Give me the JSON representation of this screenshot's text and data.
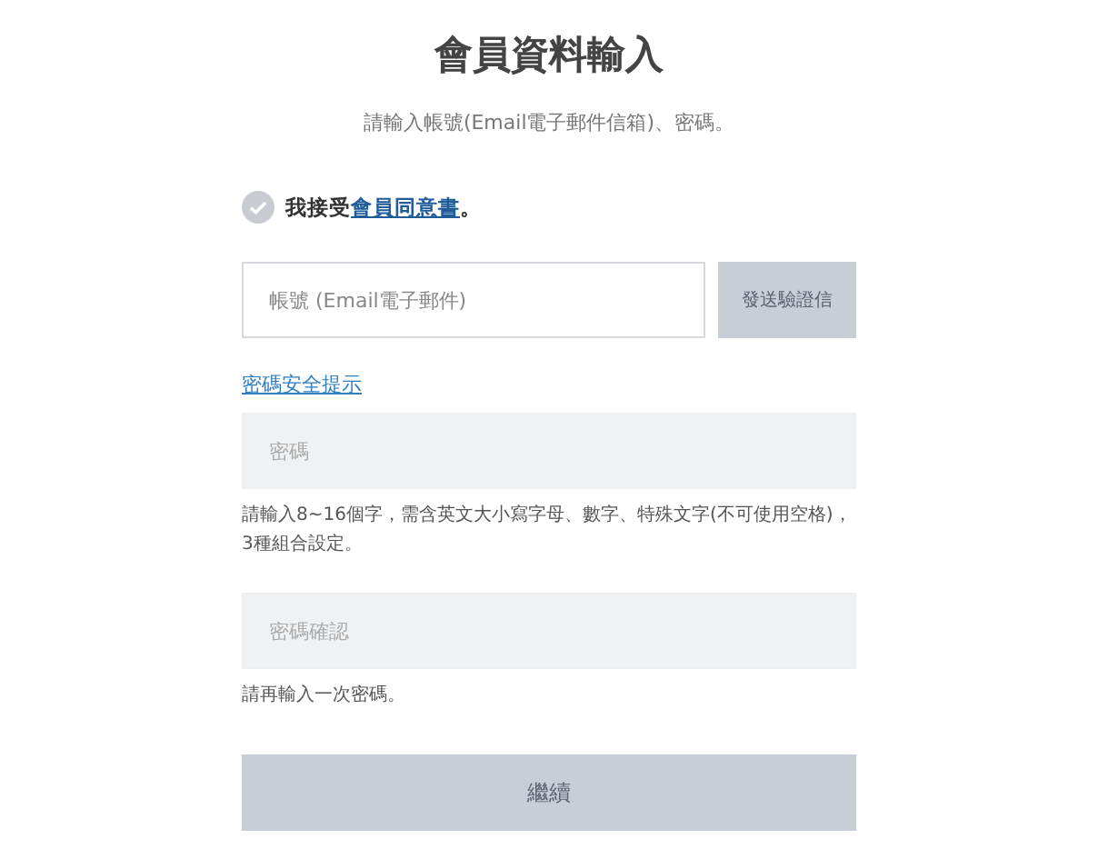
{
  "title": "會員資料輸入",
  "subtitle": "請輸入帳號(Email電子郵件信箱)、密碼。",
  "agreement": {
    "checked": false,
    "prefix": "我接受",
    "link": "會員同意書",
    "suffix": "。"
  },
  "account": {
    "placeholder": "帳號 (Email電子郵件)",
    "button": {
      "label": "發送驗證信",
      "disabled": true
    }
  },
  "password_tips_link": "密碼安全提示",
  "fields": [
    {
      "placeholder": "密碼",
      "disabled": true,
      "hint": "請輸入8~16個字，需含英文大小寫字母、數字、特殊文字(不可使用空格)，3種組合設定。"
    },
    {
      "placeholder": "密碼確認",
      "disabled": true,
      "hint": "請再輸入一次密碼。"
    }
  ],
  "submit": {
    "label": "繼續",
    "disabled": true
  }
}
